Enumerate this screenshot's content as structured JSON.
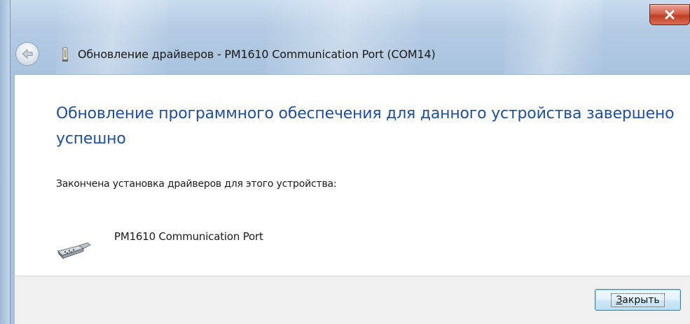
{
  "window": {
    "title": "Обновление драйверов - PM1610 Communication Port (COM14)"
  },
  "title_bar": {
    "close_glyph": "x"
  },
  "content": {
    "heading": "Обновление программного обеспечения для данного устройства завершено успешно",
    "subtext": "Закончена установка драйверов для этого устройства:",
    "device_name": "PM1610 Communication Port"
  },
  "footer": {
    "close_button_accel": "З",
    "close_button_rest": "акрыть"
  },
  "colors": {
    "heading": "#1f4f9c",
    "close_red": "#c13d26",
    "footer_bg": "#f0f0f0"
  },
  "icons": {
    "back": "back-arrow-icon",
    "device": "device-icon",
    "port": "serial-port-icon",
    "close": "close-icon"
  }
}
